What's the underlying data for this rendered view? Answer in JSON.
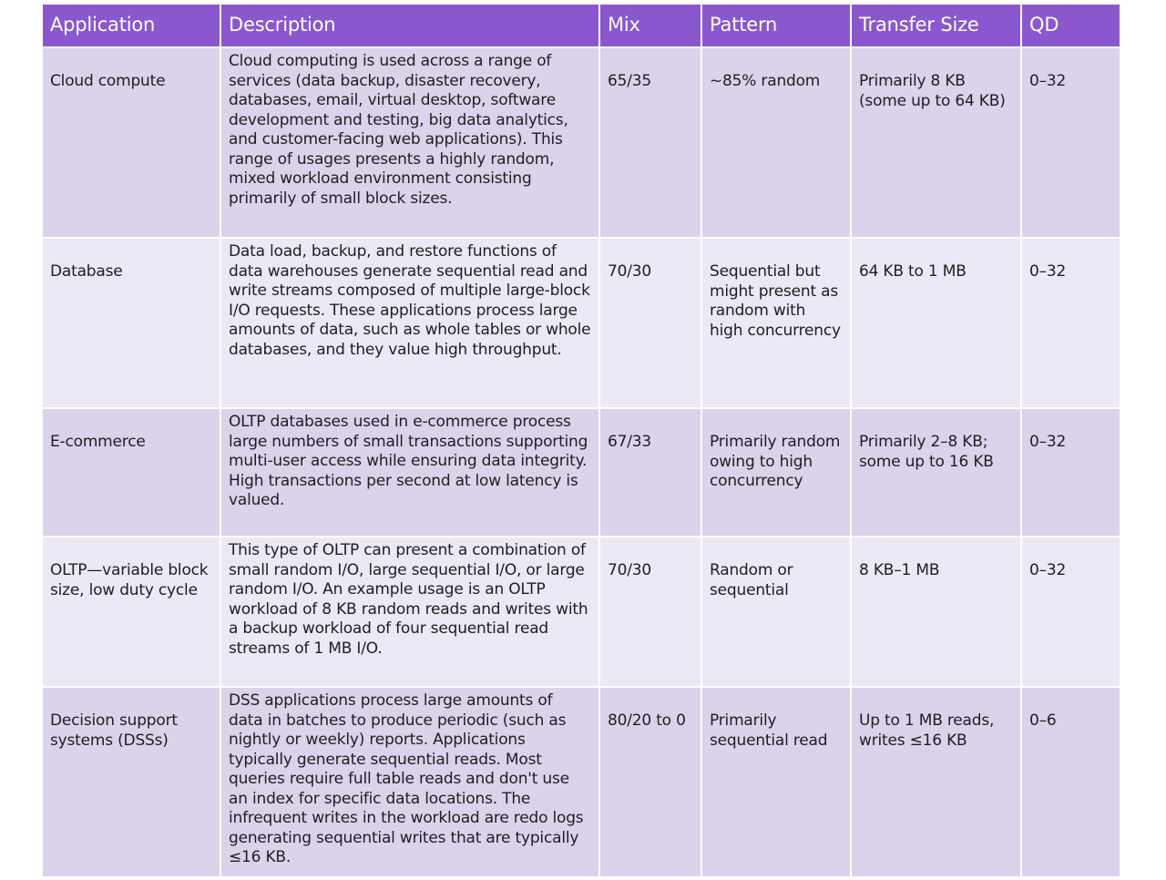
{
  "colors": {
    "header_bg": "#8b57cf",
    "header_text": "#ffffff",
    "row_odd_bg": "#dcd2ec",
    "row_even_bg": "#ece8f5",
    "border": "#ffffff",
    "text": "#1e1e1e"
  },
  "table": {
    "headers": [
      "Application",
      "Description",
      "Mix",
      "Pattern",
      "Transfer Size",
      "QD"
    ],
    "rows": [
      {
        "application": "Cloud compute",
        "description": "Cloud computing is used across a range of services (data backup, disaster recovery, databases, email, virtual desktop, software development and testing, big data analytics, and customer-facing web applications). This range of usages presents a highly random, mixed workload environment consisting primarily of small block sizes.",
        "mix": "65/35",
        "pattern": "~85% random",
        "transfer_size": "Primarily 8 KB (some up to 64 KB)",
        "qd": "0–32"
      },
      {
        "application": "Database",
        "description": "Data load, backup, and restore functions of data warehouses generate sequential read and write streams composed of multiple large-block I/O requests. These applications process large amounts of data, such as whole tables or whole databases, and they value high throughput.",
        "mix": "70/30",
        "pattern": "Sequential but might present as random with high concurrency",
        "transfer_size": "64 KB to 1 MB",
        "qd": "0–32"
      },
      {
        "application": "E-commerce",
        "description": "OLTP databases used in e-commerce process large numbers of small transactions supporting multi-user access while ensuring data integrity. High transactions per second at low latency is valued.",
        "mix": "67/33",
        "pattern": "Primarily random owing to high concurrency",
        "transfer_size": "Primarily 2–8 KB; some up to 16 KB",
        "qd": "0–32"
      },
      {
        "application": "OLTP—variable block size, low duty cycle",
        "description": "This type of OLTP can present a combination of small random I/O, large sequential I/O, or large random I/O. An example usage is an OLTP workload of 8 KB random reads and writes with a backup workload of four sequential read streams of 1 MB I/O.",
        "mix": "70/30",
        "pattern": "Random or sequential",
        "transfer_size": "8 KB–1 MB",
        "qd": "0–32"
      },
      {
        "application": "Decision support systems (DSSs)",
        "description": "DSS applications process large amounts of data in batches to produce periodic (such as nightly or weekly) reports. Applications typically generate sequential reads. Most queries require full table reads and don't use an index for specific data locations. The infrequent writes in the workload are redo logs generating sequential writes that are typically ≤16 KB.",
        "mix": "80/20 to 0",
        "pattern": "Primarily sequential read",
        "transfer_size": "Up to 1 MB reads, writes ≤16 KB",
        "qd": "0–6"
      }
    ]
  }
}
